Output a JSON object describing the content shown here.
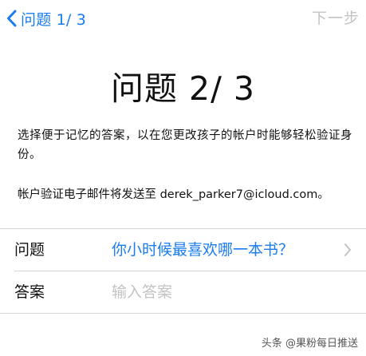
{
  "nav": {
    "back_label": "问题 1/ 3",
    "next_label": "下一步"
  },
  "title": "问题 2/ 3",
  "description": "选择便于记忆的答案，以在您更改孩子的帐户时能够轻松验证身份。",
  "email_note": "帐户验证电子邮件将发送至 derek_parker7@icloud.com。",
  "form": {
    "question_label": "问题",
    "question_value": "你小时候最喜欢哪一本书？",
    "answer_label": "答案",
    "answer_placeholder": "输入答案"
  },
  "watermark": "头条 @果粉每日推送",
  "colors": {
    "accent": "#1a7cf0",
    "disabled": "#c3c3c6",
    "separator": "#d6d6da"
  }
}
